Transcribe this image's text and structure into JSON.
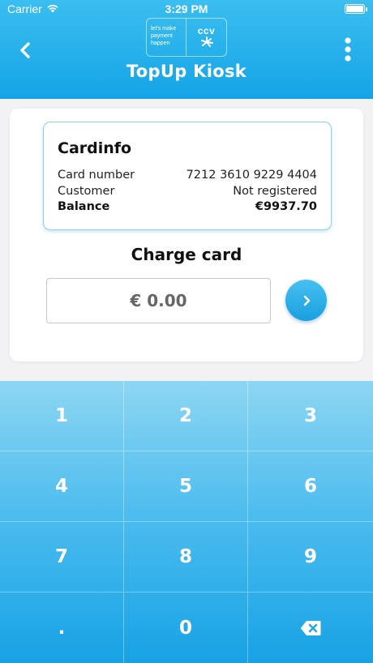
{
  "status_bar": {
    "carrier": "Carrier",
    "time": "3:29 PM"
  },
  "header": {
    "title": "TopUp Kiosk",
    "logo": {
      "tagline_line1": "let's make",
      "tagline_line2": "payment",
      "tagline_line3": "happen",
      "brand": "ccv"
    }
  },
  "card_info": {
    "title": "Cardinfo",
    "rows": [
      {
        "label": "Card number",
        "value": "7212 3610 9229 4404"
      },
      {
        "label": "Customer",
        "value": "Not registered"
      },
      {
        "label": "Balance",
        "value": "€9937.70"
      }
    ]
  },
  "charge": {
    "label": "Charge card",
    "amount": "€ 0.00"
  },
  "keypad": {
    "keys": [
      "1",
      "2",
      "3",
      "4",
      "5",
      "6",
      "7",
      "8",
      "9",
      ".",
      "0"
    ]
  },
  "colors": {
    "accent": "#14a4e6",
    "accent_light": "#8dd6f2"
  }
}
